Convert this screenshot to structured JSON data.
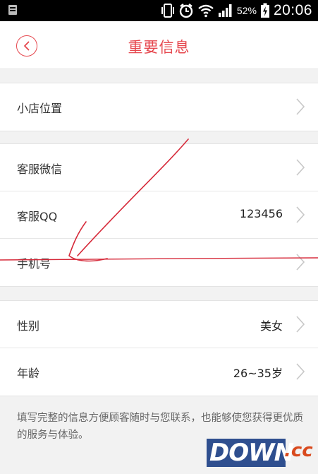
{
  "status_bar": {
    "battery_percent": "52%",
    "time": "20:06"
  },
  "header": {
    "title": "重要信息"
  },
  "sections": [
    {
      "rows": [
        {
          "label": "小店位置",
          "value": ""
        }
      ]
    },
    {
      "rows": [
        {
          "label": "客服微信",
          "value": ""
        },
        {
          "label": "客服QQ",
          "value": "123456"
        },
        {
          "label": "手机号",
          "value": ""
        }
      ]
    },
    {
      "rows": [
        {
          "label": "性别",
          "value": "美女"
        },
        {
          "label": "年龄",
          "value": "26~35岁"
        }
      ]
    }
  ],
  "note": "填写完整的信息方便顾客随时与您联系，也能够使您获得更优质的服务与体验。",
  "watermark": {
    "main": "DOWN",
    "suffix": ".cc"
  },
  "colors": {
    "accent": "#e6474e",
    "background": "#f2f2f2",
    "annotation": "#d62a3a"
  }
}
